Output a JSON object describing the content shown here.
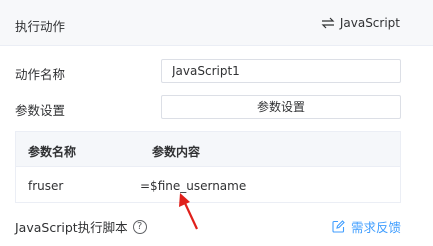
{
  "header": {
    "title": "执行动作",
    "switch_label": "JavaScript",
    "switch_icon": "swap-arrows-icon"
  },
  "form": {
    "action_name_label": "动作名称",
    "action_name_value": "JavaScript1",
    "params_label": "参数设置",
    "params_button": "参数设置"
  },
  "table": {
    "headers": [
      "参数名称",
      "参数内容"
    ],
    "rows": [
      {
        "name": "fruser",
        "value": "=$fine_username"
      }
    ]
  },
  "script": {
    "label": "JavaScript执行脚本",
    "help_icon": "question-circle-icon"
  },
  "feedback": {
    "label": "需求反馈",
    "icon": "edit-icon"
  },
  "colors": {
    "accent": "#409eff",
    "arrow": "#e0201b",
    "header_bg": "#f7f8fa"
  }
}
